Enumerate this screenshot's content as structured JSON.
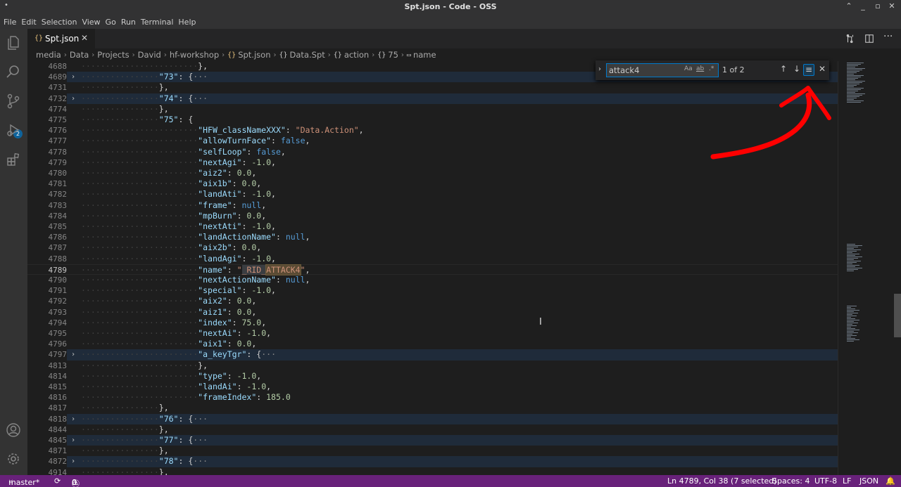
{
  "window": {
    "title": "Spt.json - Code - OSS",
    "controls": [
      "⌃",
      "_",
      "▫",
      "✕"
    ]
  },
  "menu": [
    "File",
    "Edit",
    "Selection",
    "View",
    "Go",
    "Run",
    "Terminal",
    "Help"
  ],
  "activity_bar": {
    "scm_badge": "2",
    "icons": [
      "explorer-icon",
      "search-icon",
      "source-control-icon",
      "run-debug-icon",
      "extensions-icon",
      "account-icon",
      "settings-gear-icon"
    ]
  },
  "tab": {
    "icon": "{}",
    "label": "Spt.json",
    "close": "✕"
  },
  "breadcrumb": [
    "media",
    "Data",
    "Projects",
    "David",
    "hf-workshop",
    "Spt.json",
    "Data.Spt",
    "action",
    "75",
    "name"
  ],
  "find": {
    "query": "attack4",
    "count": "1 of 2",
    "opt_case": "Aa",
    "opt_word": "ab",
    "opt_regex": ".*"
  },
  "editor": {
    "lines": [
      {
        "n": "4688",
        "t": "},"
      },
      {
        "n": "4689",
        "t": "\"73\": {···"
      },
      {
        "n": "4731",
        "t": "},"
      },
      {
        "n": "4732",
        "t": "\"74\": {···"
      },
      {
        "n": "4774",
        "t": "},"
      },
      {
        "n": "4775",
        "t": "\"75\": {"
      },
      {
        "n": "4776",
        "t": "\"HFW_classNameXXX\": \"Data.Action\","
      },
      {
        "n": "4777",
        "t": "\"allowTurnFace\": false,"
      },
      {
        "n": "4778",
        "t": "\"selfLoop\": false,"
      },
      {
        "n": "4779",
        "t": "\"nextAgi\": -1.0,"
      },
      {
        "n": "4780",
        "t": "\"aiz2\": 0.0,"
      },
      {
        "n": "4781",
        "t": "\"aix1b\": 0.0,"
      },
      {
        "n": "4782",
        "t": "\"landAti\": -1.0,"
      },
      {
        "n": "4783",
        "t": "\"frame\": null,"
      },
      {
        "n": "4784",
        "t": "\"mpBurn\": 0.0,"
      },
      {
        "n": "4785",
        "t": "\"nextAti\": -1.0,"
      },
      {
        "n": "4786",
        "t": "\"landActionName\": null,"
      },
      {
        "n": "4787",
        "t": "\"aix2b\": 0.0,"
      },
      {
        "n": "4788",
        "t": "\"landAgi\": -1.0,"
      },
      {
        "n": "4789",
        "t": "\"name\": \"_RID_ATTACK4\","
      },
      {
        "n": "4790",
        "t": "\"nextActionName\": null,"
      },
      {
        "n": "4791",
        "t": "\"special\": -1.0,"
      },
      {
        "n": "4792",
        "t": "\"aix2\": 0.0,"
      },
      {
        "n": "4793",
        "t": "\"aiz1\": 0.0,"
      },
      {
        "n": "4794",
        "t": "\"index\": 75.0,"
      },
      {
        "n": "4795",
        "t": "\"nextAi\": -1.0,"
      },
      {
        "n": "4796",
        "t": "\"aix1\": 0.0,"
      },
      {
        "n": "4797",
        "t": "\"a_keyTgr\": {···"
      },
      {
        "n": "4813",
        "t": "},"
      },
      {
        "n": "4814",
        "t": "\"type\": -1.0,"
      },
      {
        "n": "4815",
        "t": "\"landAi\": -1.0,"
      },
      {
        "n": "4816",
        "t": "\"frameIndex\": 185.0"
      },
      {
        "n": "4817",
        "t": "},"
      },
      {
        "n": "4818",
        "t": "\"76\": {···"
      },
      {
        "n": "4844",
        "t": "},"
      },
      {
        "n": "4845",
        "t": "\"77\": {···"
      },
      {
        "n": "4871",
        "t": "},"
      },
      {
        "n": "4872",
        "t": "\"78\": {···"
      },
      {
        "n": "4914",
        "t": "},"
      }
    ]
  },
  "status": {
    "branch": "master*",
    "errors": "0",
    "warnings": "0",
    "position": "Ln 4789, Col 38 (7 selected)",
    "spaces": "Spaces: 4",
    "encoding": "UTF-8",
    "eol": "LF",
    "language": "JSON"
  },
  "colors": {
    "statusbar": "#68217a",
    "annotation": "#ff0000",
    "accent": "#007acc"
  }
}
